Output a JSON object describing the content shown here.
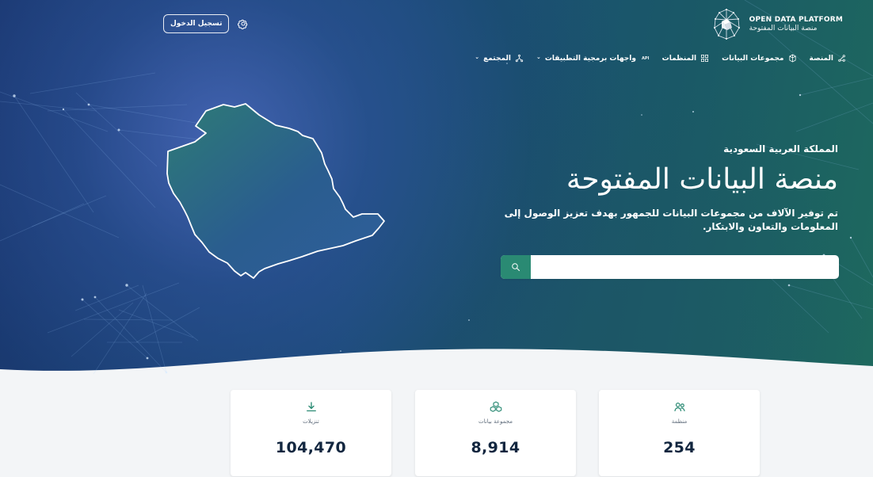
{
  "header": {
    "logo": {
      "en": "OPEN DATA PLATFORM",
      "ar": "منصة البيانات المفتوحة"
    },
    "login_label": "تسجيل الدخول",
    "settings_icon": "gear-icon",
    "nav": [
      {
        "label": "المنصة",
        "icon": "nodes-icon"
      },
      {
        "label": "مجموعات البيانات",
        "icon": "box-icon"
      },
      {
        "label": "المنظمات",
        "icon": "grid-icon"
      },
      {
        "label": "واجهات برمجية التطبيقات",
        "badge": "API",
        "icon": "api-icon"
      },
      {
        "label": "المجتمع",
        "icon": "community-icon"
      }
    ]
  },
  "hero": {
    "country": "المملكة العربية السعودية",
    "title": "منصة البيانات المفتوحة",
    "description": "تم توفير الآلاف من مجموعات البيانات للجمهور بهدف تعزيز الوصول إلى المعلومات والتعاون والابتكار.",
    "search": {
      "placeholder": "",
      "value": ""
    }
  },
  "stats": [
    {
      "label": "تنزيلات",
      "value": "104,470",
      "icon": "download-icon"
    },
    {
      "label": "مجموعة بيانات",
      "value": "8,914",
      "icon": "cubes-icon"
    },
    {
      "label": "منظمة",
      "value": "254",
      "icon": "users-icon"
    }
  ],
  "colors": {
    "hero_gradient_start": "#19356f",
    "hero_gradient_mid": "#1c4d7a",
    "hero_gradient_end": "#1e6a5d",
    "accent_green": "#2a8a73",
    "card_text": "#12263f"
  }
}
